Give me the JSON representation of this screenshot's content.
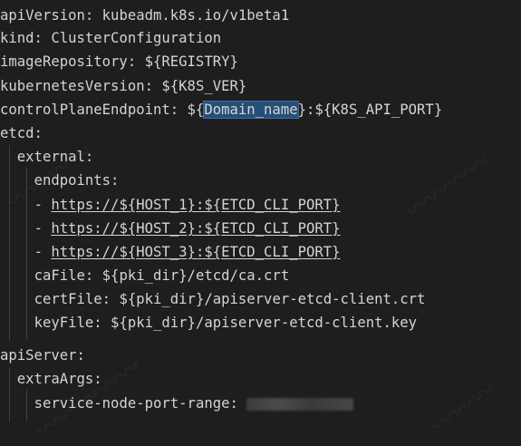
{
  "editor": {
    "lines": {
      "l1": {
        "key": "apiVersion:",
        "value": " kubeadm.k8s.io/v1beta1"
      },
      "l2": {
        "key": "kind:",
        "value": " ClusterConfiguration"
      },
      "l3": {
        "key": "imageRepository:",
        "value": " ${REGISTRY}"
      },
      "l4": {
        "key": "kubernetesVersion:",
        "value": " ${K8S_VER}"
      },
      "l5": {
        "key": "controlPlaneEndpoint:",
        "pre": " ${",
        "selected": "Domain_name",
        "post": "}:${K8S_API_PORT}"
      },
      "l6": {
        "key": "etcd:"
      },
      "l7": {
        "key": "external:"
      },
      "l8": {
        "key": "endpoints:"
      },
      "l9": {
        "dash": "- ",
        "link": "https://${HOST_1}:${ETCD_CLI_PORT}"
      },
      "l10": {
        "dash": "- ",
        "link": "https://${HOST_2}:${ETCD_CLI_PORT}"
      },
      "l11": {
        "dash": "- ",
        "link": "https://${HOST_3}:${ETCD_CLI_PORT}"
      },
      "l12": {
        "key": "caFile:",
        "value": " ${pki_dir}/etcd/ca.crt"
      },
      "l13": {
        "key": "certFile:",
        "value": " ${pki_dir}/apiserver-etcd-client.crt"
      },
      "l14": {
        "key": "keyFile:",
        "value": " ${pki_dir}/apiserver-etcd-client.key"
      },
      "l15": {
        "key": "apiServer:"
      },
      "l16": {
        "key": "extraArgs:"
      },
      "l17": {
        "key": "service-node-port-range:"
      }
    },
    "colors": {
      "background": "#1e1e1e",
      "text": "#d4d4d4",
      "selection": "#264f78",
      "indent_guide": "#404040"
    }
  }
}
